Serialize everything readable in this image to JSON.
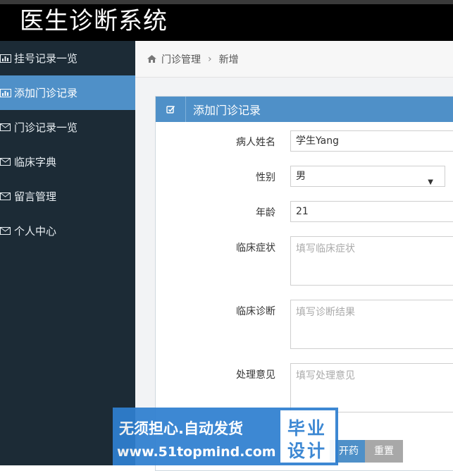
{
  "app": {
    "title": "医生诊断系统"
  },
  "sidebar": {
    "items": [
      {
        "label": "挂号记录一览",
        "icon": "bar-chart-icon"
      },
      {
        "label": "添加门诊记录",
        "icon": "bar-chart-icon",
        "active": true
      },
      {
        "label": "门诊记录一览",
        "icon": "envelope-icon"
      },
      {
        "label": "临床字典",
        "icon": "envelope-icon"
      },
      {
        "label": "留言管理",
        "icon": "envelope-icon"
      },
      {
        "label": "个人中心",
        "icon": "envelope-icon"
      }
    ]
  },
  "breadcrumb": {
    "home_icon": "home-icon",
    "parent": "门诊管理",
    "separator": "›",
    "current": "新增"
  },
  "form": {
    "title": "添加门诊记录",
    "title_icon": "edit-check-icon",
    "fields": {
      "name": {
        "label": "病人姓名",
        "value": "学生Yang"
      },
      "gender": {
        "label": "性别",
        "value": "男"
      },
      "age": {
        "label": "年龄",
        "value": "21"
      },
      "symptoms": {
        "label": "临床症状",
        "placeholder": "填写临床症状"
      },
      "diagnosis": {
        "label": "临床诊断",
        "placeholder": "填写诊断结果"
      },
      "opinion": {
        "label": "处理意见",
        "placeholder": "填写处理意见"
      }
    },
    "buttons": {
      "submit_partial": "开药",
      "reset": "重置"
    }
  },
  "watermark": {
    "line1": "无须担心.自动发货",
    "line2": "www.51topmind.com",
    "badge_line1": "毕业",
    "badge_line2": "设计"
  },
  "colors": {
    "accent": "#4f90c8",
    "sidebar_bg": "#1c2b36",
    "topbar_bg": "#000000",
    "watermark_bg": "#2f7fd0"
  }
}
